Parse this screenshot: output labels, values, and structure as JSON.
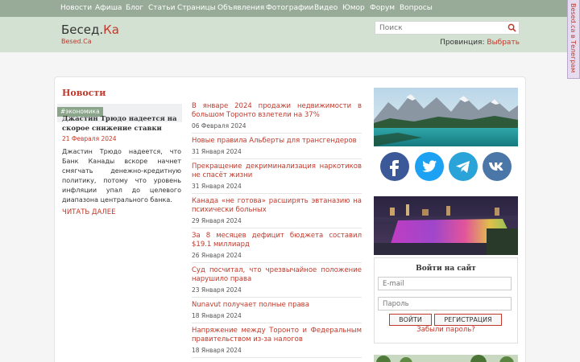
{
  "topnav": {
    "items": [
      "Новости",
      "Афиша",
      "Блог",
      "Статьи",
      "Страницы",
      "Объявления",
      "Фотографии",
      "Видео",
      "Юмор",
      "Форум",
      "Вопросы"
    ]
  },
  "header": {
    "logo_main": "Бесед.",
    "logo_accent": "Ка",
    "logo_sub": "Besed.Ca",
    "search_placeholder": "Поиск",
    "province_label": "Провинция:",
    "province_link": "Выбрать"
  },
  "telegram_tab": "Besed.ca в Телеграм",
  "section_title": "Новости",
  "featured": {
    "tag": "#экономика",
    "title": "Джастин Трюдо надеется на скорое снижение ставки",
    "date": "21 Февраля 2024",
    "text": "Джастин Трюдо надеется, что Банк Канады вскоре начнет смягчать денежно-кредитную политику, потому что уровень инфляции упал до целевого диапазона центрального банка.",
    "read_more": "ЧИТАТЬ ДАЛЕЕ"
  },
  "news": [
    {
      "title": "В январе 2024 продажи недвижимости в большом Торонто взлетели на 37%",
      "date": "06 Февраля 2024"
    },
    {
      "title": "Новые правила Альберты для трансгендеров",
      "date": "31 Января 2024"
    },
    {
      "title": "Прекращение декриминализация наркотиков не спасёт жизни",
      "date": "31 Января 2024"
    },
    {
      "title": "Канада «не готова» расширять эвтаназию на психически больных",
      "date": "29 Января 2024"
    },
    {
      "title": "За 8 месяцев дефицит бюджета составил $19.1 миллиард",
      "date": "26 Января 2024"
    },
    {
      "title": "Суд посчитал, что чрезвычайное положение нарушило права",
      "date": "23 Января 2024"
    },
    {
      "title": "Nunavut получает полные права",
      "date": "18 Января 2024"
    },
    {
      "title": "Напряжение между Торонто и Федеральным правительством из-за налогов",
      "date": "18 Января 2024"
    }
  ],
  "social": [
    {
      "name": "facebook",
      "color": "#3b5998"
    },
    {
      "name": "twitter",
      "color": "#1da1f2"
    },
    {
      "name": "telegram",
      "color": "#2aa3d9"
    },
    {
      "name": "vk",
      "color": "#4a76a8"
    }
  ],
  "login": {
    "title": "Войти на сайт",
    "email_placeholder": "E-mail",
    "password_placeholder": "Пароль",
    "login_button": "ВОЙТИ",
    "register_button": "РЕГИСТРАЦИЯ",
    "forgot": "Забыли пароль?"
  },
  "colors": {
    "accent": "#c0392b",
    "topnav_bg": "#98ab98",
    "header_bg": "#d3e1d3",
    "tag_bg": "#8aa58a"
  }
}
